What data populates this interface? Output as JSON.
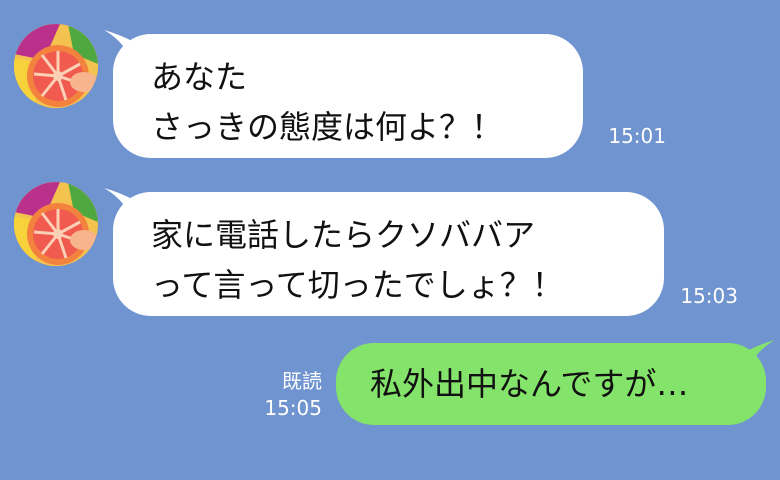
{
  "chat": {
    "messages": [
      {
        "direction": "incoming",
        "lines": [
          "あなた",
          "さっきの態度は何よ？！"
        ],
        "time": "15:01",
        "avatar_icon": "grapefruit-avatar-icon"
      },
      {
        "direction": "incoming",
        "lines": [
          "家に電話したらクソババア",
          "って言って切ったでしょ？！"
        ],
        "time": "15:03",
        "avatar_icon": "grapefruit-avatar-icon"
      },
      {
        "direction": "outgoing",
        "lines": [
          "私外出中なんですが…"
        ],
        "read_label": "既読",
        "time": "15:05"
      }
    ]
  },
  "colors": {
    "background": "#7094cf",
    "incoming_bubble": "#ffffff",
    "outgoing_bubble": "#84e36a",
    "timestamp_text": "#ffffff"
  }
}
